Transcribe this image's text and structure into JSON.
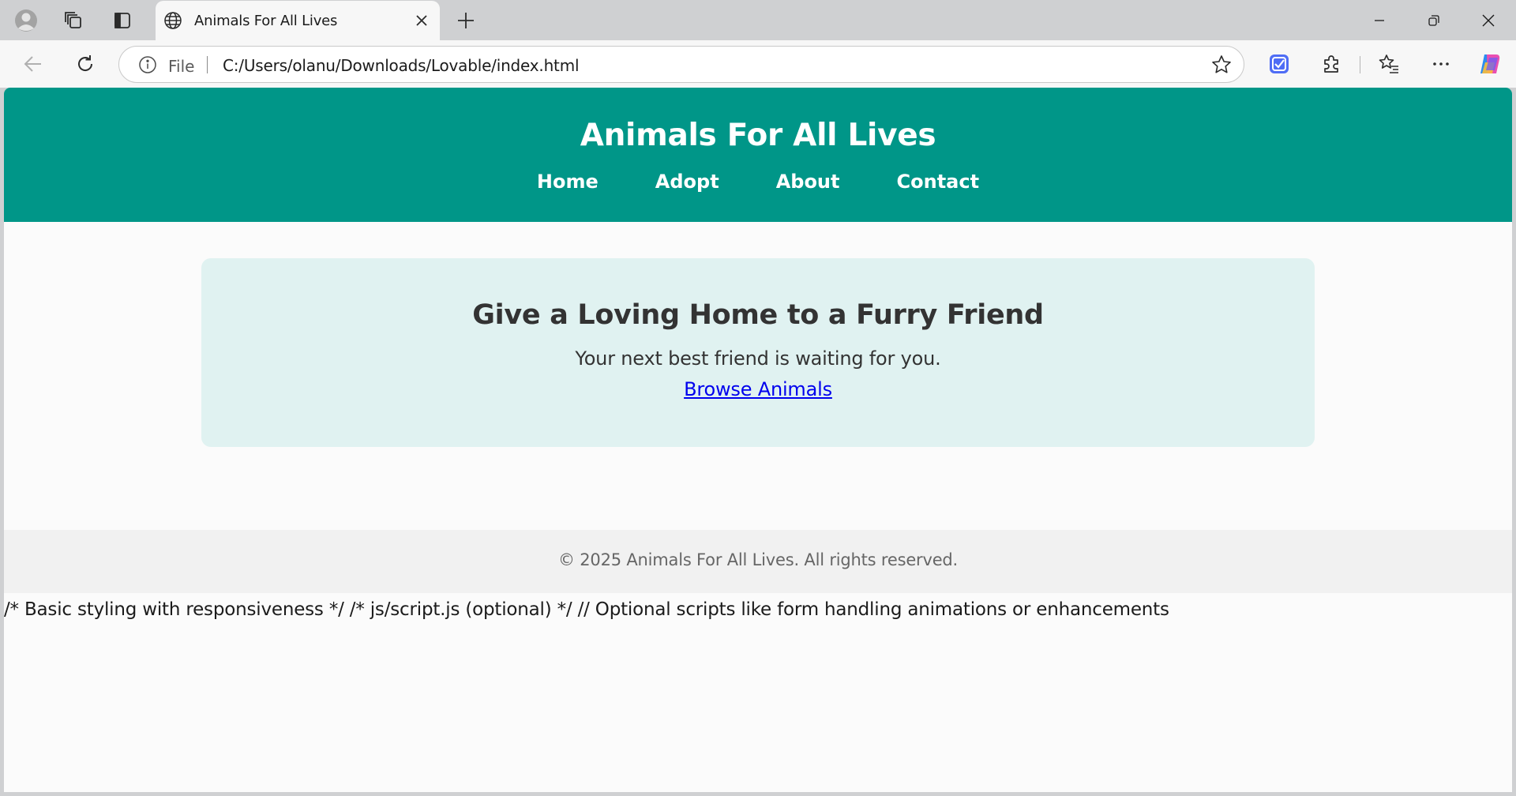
{
  "browser": {
    "tab": {
      "title": "Animals For All Lives"
    },
    "address_bar": {
      "scheme_label": "File",
      "url": "C:/Users/olanu/Downloads/Lovable/index.html"
    },
    "icons": {
      "profile": "profile-avatar-icon",
      "workspaces": "workspaces-icon",
      "tab_actions": "tab-actions-icon",
      "favicon": "globe-icon",
      "close_tab": "close-icon",
      "new_tab": "plus-icon",
      "minimize": "minimize-icon",
      "restore": "restore-icon",
      "close_window": "close-icon",
      "back": "back-arrow-icon",
      "reload": "reload-icon",
      "info": "info-icon",
      "favorite": "star-icon",
      "extension_active": "extension-shield-icon",
      "extensions": "puzzle-icon",
      "favorites": "favorites-list-icon",
      "more": "more-dots-icon",
      "copilot": "copilot-icon"
    }
  },
  "site": {
    "header": {
      "title": "Animals For All Lives",
      "nav": [
        "Home",
        "Adopt",
        "About",
        "Contact"
      ]
    },
    "hero": {
      "heading": "Give a Loving Home to a Furry Friend",
      "text": "Your next best friend is waiting for you.",
      "link": "Browse Animals"
    },
    "footer": {
      "text": "© 2025 Animals For All Lives. All rights reserved."
    },
    "stray_text": "/* Basic styling with responsiveness */ /* js/script.js (optional) */ // Optional scripts like form handling animations or enhancements"
  },
  "colors": {
    "header_bg": "#009688",
    "hero_bg": "#e0f2f1",
    "link": "#0000ee",
    "footer_bg": "#f1f1f1"
  }
}
